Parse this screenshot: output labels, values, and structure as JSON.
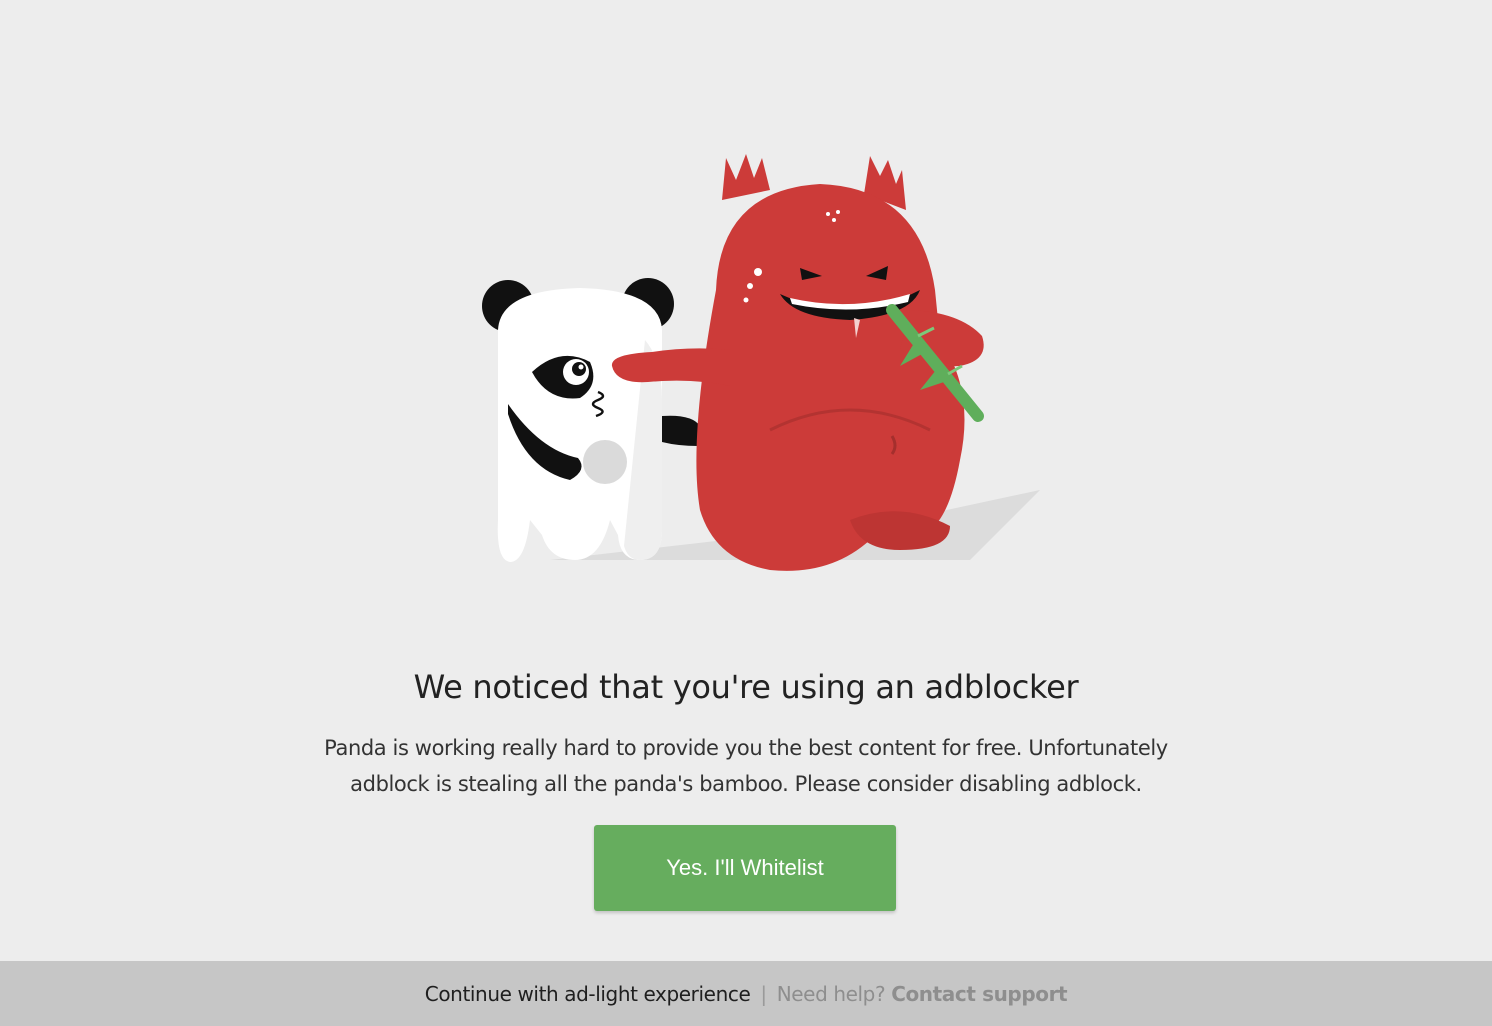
{
  "dialog": {
    "headline": "We noticed that you're using an adblocker",
    "body_line_1": "Panda is working really hard to provide you the best content for free. Unfortunately",
    "body_line_2": "adblock is stealing all the panda's bamboo. Please consider disabling adblock.",
    "whitelist_label": "Yes. I'll Whitelist"
  },
  "footer": {
    "continue_label": "Continue with ad-light experience",
    "divider": "|",
    "help_text": "Need help?",
    "support_label": "Contact support"
  },
  "colors": {
    "background": "#ededed",
    "button": "#66ad5e",
    "footer_bar": "#c6c6c6",
    "monster_red": "#cc3b39"
  },
  "illustration": {
    "icons": [
      "panda-icon",
      "red-monster-icon",
      "bamboo-icon"
    ]
  }
}
